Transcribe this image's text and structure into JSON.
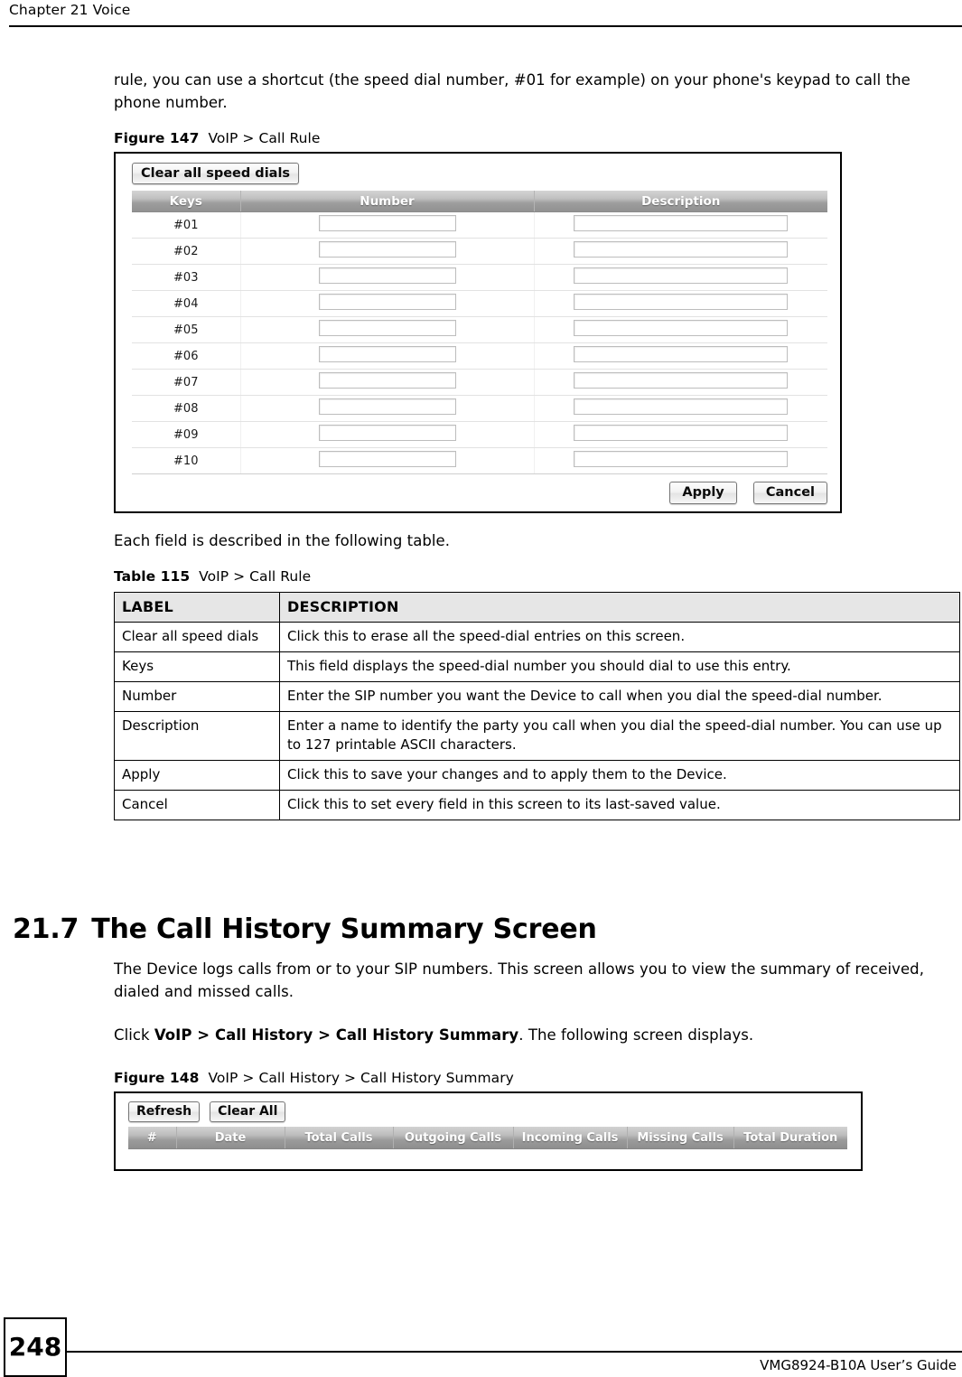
{
  "header": {
    "chapter_title": "Chapter 21 Voice"
  },
  "intro_paragraph": "rule, you can use a shortcut (the speed dial number, #01 for example) on your phone's keypad to call the phone number.",
  "figure_147": {
    "caption_label": "Figure 147",
    "caption_text": "VoIP > Call Rule",
    "clear_button": "Clear all speed dials",
    "columns": [
      "Keys",
      "Number",
      "Description"
    ],
    "rows": [
      {
        "key": "#01",
        "number": "",
        "description": ""
      },
      {
        "key": "#02",
        "number": "",
        "description": ""
      },
      {
        "key": "#03",
        "number": "",
        "description": ""
      },
      {
        "key": "#04",
        "number": "",
        "description": ""
      },
      {
        "key": "#05",
        "number": "",
        "description": ""
      },
      {
        "key": "#06",
        "number": "",
        "description": ""
      },
      {
        "key": "#07",
        "number": "",
        "description": ""
      },
      {
        "key": "#08",
        "number": "",
        "description": ""
      },
      {
        "key": "#09",
        "number": "",
        "description": ""
      },
      {
        "key": "#10",
        "number": "",
        "description": ""
      }
    ],
    "apply_button": "Apply",
    "cancel_button": "Cancel"
  },
  "each_field_paragraph": "Each field is described in the following table.",
  "table_115": {
    "caption_label": "Table 115",
    "caption_text": "VoIP > Call Rule",
    "headers": [
      "LABEL",
      "DESCRIPTION"
    ],
    "rows": [
      {
        "label": "Clear all speed dials",
        "description": "Click this to erase all the speed-dial entries on this screen."
      },
      {
        "label": "Keys",
        "description": "This field displays the speed-dial number you should dial to use this entry."
      },
      {
        "label": "Number",
        "description": "Enter the SIP number you want the Device to call when you dial the speed-dial number."
      },
      {
        "label": "Description",
        "description": "Enter a name to identify the party you call when you dial the speed-dial number. You can use up to 127 printable ASCII characters."
      },
      {
        "label": "Apply",
        "description": "Click this to save your changes and to apply them to the Device."
      },
      {
        "label": "Cancel",
        "description": "Click this to set every field in this screen to its last-saved value."
      }
    ]
  },
  "section_21_7": {
    "number": "21.7",
    "title": "The Call History Summary Screen",
    "paragraph_1": "The Device logs calls from or to your SIP numbers. This screen allows you to view the summary of received, dialed and missed calls.",
    "paragraph_2_prefix": "Click ",
    "paragraph_2_bold": "VoIP > Call History > Call History Summary",
    "paragraph_2_suffix": ". The following screen displays."
  },
  "figure_148": {
    "caption_label": "Figure 148",
    "caption_text": "VoIP > Call History > Call History Summary",
    "refresh_button": "Refresh",
    "clear_all_button": "Clear All",
    "columns": [
      "#",
      "Date",
      "Total Calls",
      "Outgoing Calls",
      "Incoming Calls",
      "Missing Calls",
      "Total Duration"
    ],
    "rows": []
  },
  "footer": {
    "page_number": "248",
    "guide_name": "VMG8924-B10A User’s Guide"
  }
}
